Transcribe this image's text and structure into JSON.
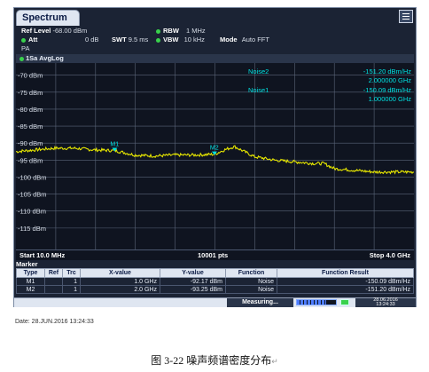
{
  "app": {
    "tab_title": "Spectrum",
    "menu_icon": "hamburger-menu-icon"
  },
  "settings": {
    "ref_level_label": "Ref Level",
    "ref_level_value": "-68.00 dBm",
    "att_label": "Att",
    "att_value": "0 dB",
    "swt_label": "SWT",
    "swt_value": "9.5 ms",
    "rbw_label": "RBW",
    "rbw_value": "1 MHz",
    "vbw_label": "VBW",
    "vbw_value": "10 kHz",
    "mode_label": "Mode",
    "mode_value": "Auto FFT",
    "pa_label": "PA"
  },
  "trace_label": "1Sa AvgLog",
  "noise_readouts": [
    {
      "name": "Noise2",
      "value": "-151.20 dBm/Hz",
      "freq": "2.000000 GHz"
    },
    {
      "name": "Noise1",
      "value": "-150.09 dBm/Hz",
      "freq": "1.000000 GHz"
    }
  ],
  "chart_data": {
    "type": "line",
    "y_unit": "dBm",
    "ylim": [
      -120,
      -68
    ],
    "y_ticks": [
      "-70 dBm",
      "-75 dBm",
      "-80 dBm",
      "-85 dBm",
      "-90 dBm",
      "-95 dBm",
      "-100 dBm",
      "-105 dBm",
      "-110 dBm",
      "-115 dBm"
    ],
    "y_tick_values": [
      -70,
      -75,
      -80,
      -85,
      -90,
      -95,
      -100,
      -105,
      -110,
      -115
    ],
    "xlim_ghz": [
      0.01,
      4.0
    ],
    "grid": true,
    "trace_color": "#e6e600",
    "series": [
      {
        "x_ghz": [
          0.01,
          0.2,
          0.4,
          0.6,
          0.8,
          1.0,
          1.2,
          1.4,
          1.6,
          1.8,
          2.0,
          2.1,
          2.2,
          2.4,
          2.6,
          2.8,
          3.0,
          3.1,
          3.2,
          3.4,
          3.6,
          3.8,
          4.0
        ],
        "y_dbm": [
          -92.5,
          -92.0,
          -91.5,
          -91.5,
          -92.0,
          -92.2,
          -93.5,
          -93.8,
          -93.5,
          -93.5,
          -93.3,
          -92.0,
          -91.0,
          -94.0,
          -95.0,
          -95.5,
          -96.0,
          -96.0,
          -97.5,
          -98.0,
          -98.5,
          -98.5,
          -98.5
        ]
      }
    ],
    "markers": [
      {
        "label": "M1",
        "x_ghz": 1.0,
        "y_dbm": -92.17
      },
      {
        "label": "M2",
        "x_ghz": 2.0,
        "y_dbm": -93.25
      }
    ]
  },
  "axis_info": {
    "start": "Start 10.0 MHz",
    "points": "10001 pts",
    "stop": "Stop 4.0 GHz"
  },
  "marker_table": {
    "title": "Marker",
    "headers": [
      "Type",
      "Ref",
      "Trc",
      "X-value",
      "Y-value",
      "Function",
      "Function Result"
    ],
    "rows": [
      [
        "M1",
        "",
        "1",
        "1.0 GHz",
        "-92.17 dBm",
        "Noise",
        "-150.09 dBm/Hz"
      ],
      [
        "M2",
        "",
        "1",
        "2.0 GHz",
        "-93.25 dBm",
        "Noise",
        "-151.20 dBm/Hz"
      ]
    ]
  },
  "status_bar": {
    "measuring": "Measuring...",
    "progress_fraction": 0.75,
    "date_line1": "28.06.2016",
    "date_line2": "13:24:33"
  },
  "footer": {
    "date_text": "Date: 28.JUN.2016  13:24:33",
    "caption": "图  3-22 噪声频谱密度分布"
  }
}
